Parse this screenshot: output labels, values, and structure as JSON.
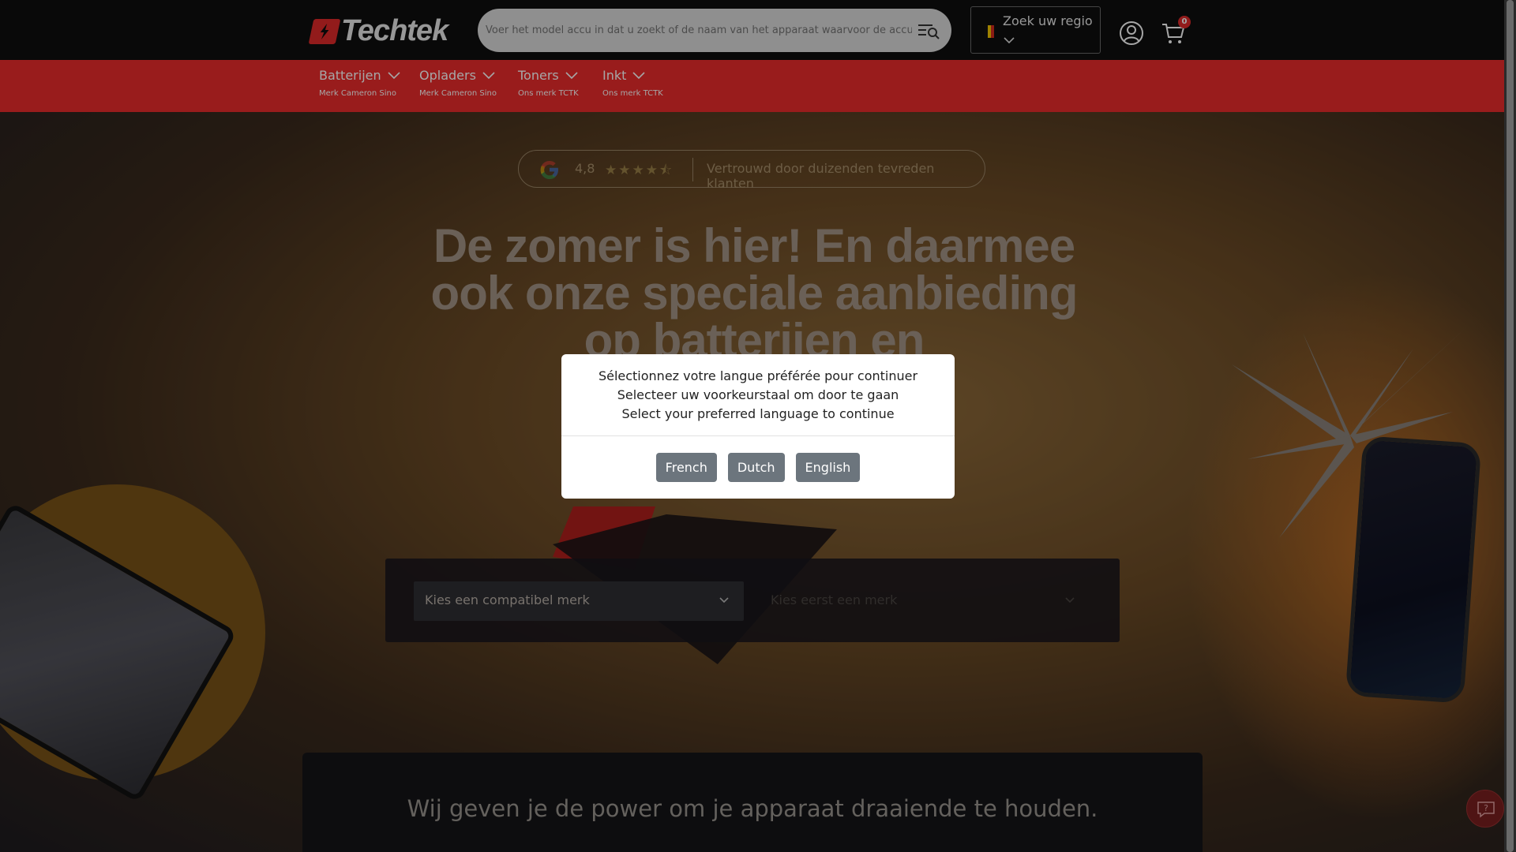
{
  "header": {
    "logo_text": "Techtek",
    "search_placeholder": "Voer het model accu in dat u zoekt of de naam van het apparaat waarvoor de accu be",
    "region_label": "Zoek uw regio",
    "cart_count": "0"
  },
  "nav": {
    "items": [
      {
        "label": "Batterijen",
        "sub": "Merk Cameron Sino"
      },
      {
        "label": "Opladers",
        "sub": "Merk Cameron Sino"
      },
      {
        "label": "Toners",
        "sub": "Ons merk TCTK"
      },
      {
        "label": "Inkt",
        "sub": "Ons merk TCTK"
      }
    ]
  },
  "hero": {
    "rating_score": "4,8",
    "rating_stars": "★★★★⯪",
    "trust_text": "Vertrouwd door duizenden tevreden klanten",
    "headline": "De zomer is hier! En daarmee ook onze speciale aanbieding op batterijen en",
    "brand_select": "Kies een compatibel merk",
    "model_select": "Kies eerst een merk",
    "tagline": "Wij geven je de power om je apparaat draaiende te houden."
  },
  "modal": {
    "line_fr": "Sélectionnez votre langue préférée pour continuer",
    "line_nl": "Selecteer uw voorkeurstaal om door te gaan",
    "line_en": "Select your preferred language to continue",
    "buttons": [
      "French",
      "Dutch",
      "English"
    ]
  },
  "colors": {
    "accent_red": "#ec2b2b",
    "header_bg": "#0f0f0f",
    "modal_button": "#6c757d"
  },
  "icons": [
    "search-filter-icon",
    "chevron-down-icon",
    "account-icon",
    "cart-icon",
    "google-icon",
    "help-icon"
  ]
}
